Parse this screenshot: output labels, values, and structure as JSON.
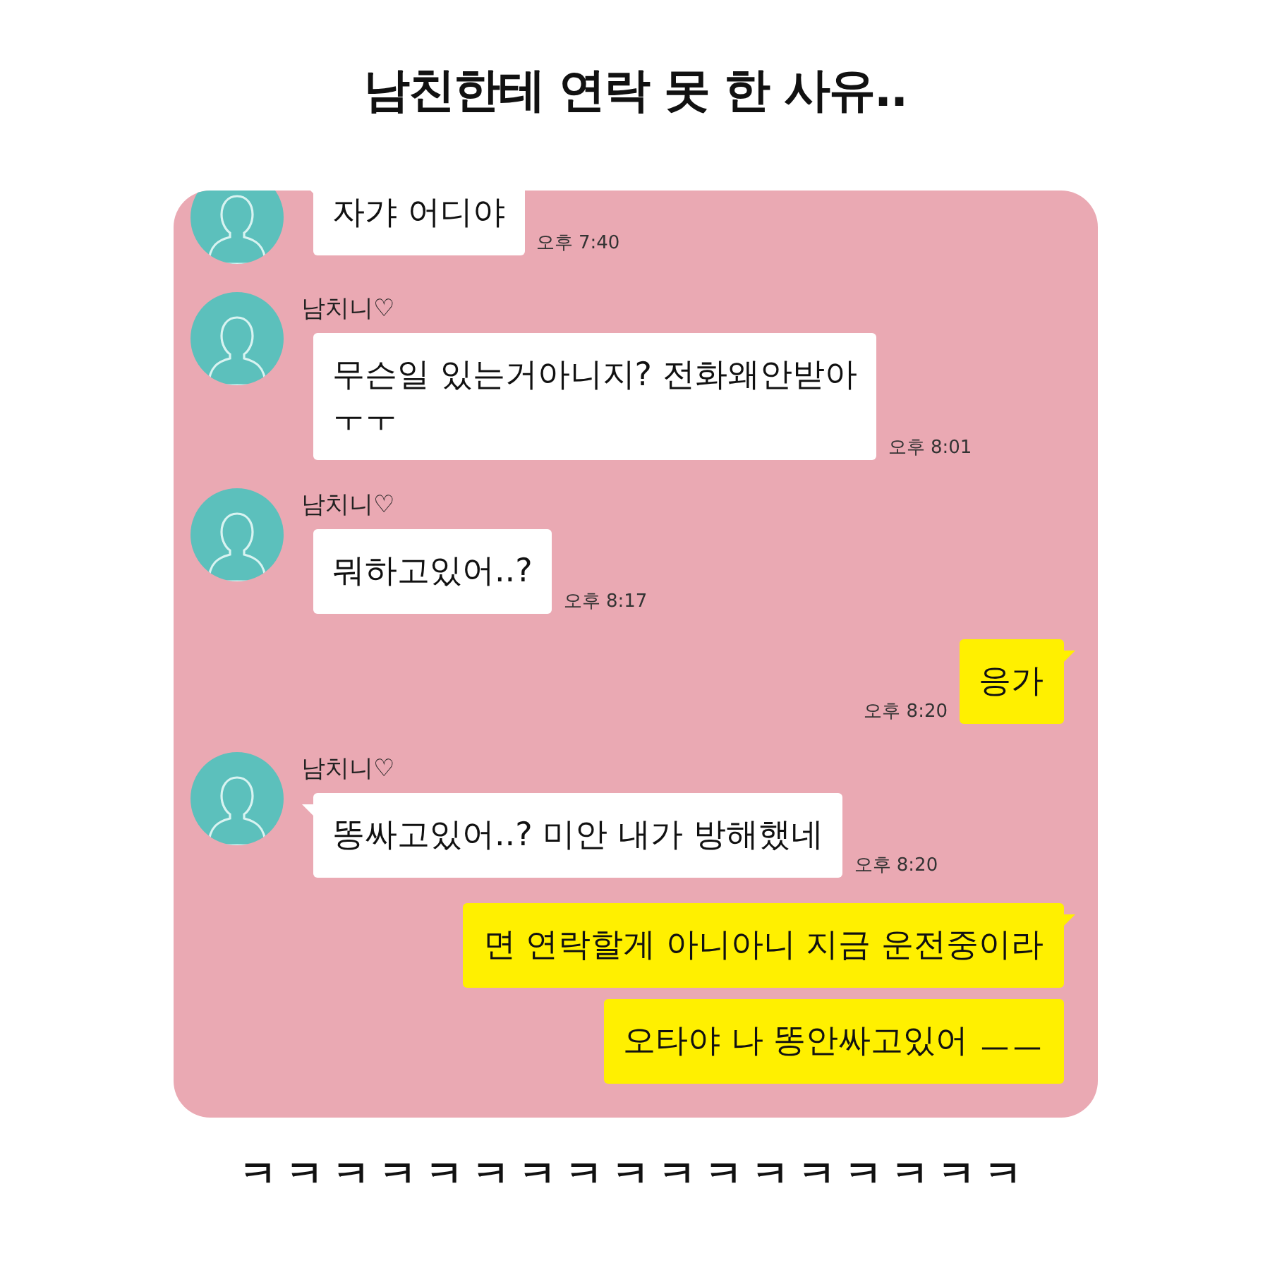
{
  "title": "남친한테 연락 못 한 사유..",
  "chat": {
    "messages": [
      {
        "kind": "received",
        "text": "자갸 어디야",
        "time": "오후 7:40"
      },
      {
        "kind": "received",
        "sender": "남치니♡",
        "text": "무슨일 있는거아니지? 전화왜안받아\nㅜㅜ",
        "time": "오후 8:01"
      },
      {
        "kind": "received",
        "sender": "남치니♡",
        "text": "뭐하고있어..?",
        "time": "오후 8:17"
      },
      {
        "kind": "sent",
        "text": "응가",
        "time": "오후 8:20"
      },
      {
        "kind": "received",
        "sender": "남치니♡",
        "text": "똥싸고있어..? 미안 내가 방해했네",
        "time": "오후 8:20"
      },
      {
        "kind": "sent",
        "text": "면 연락할게 아니아니 지금 운전중이라"
      },
      {
        "kind": "sent",
        "text": "오타야 나 똥안싸고있어 ㅡㅡ"
      }
    ]
  },
  "caption": "ㅋㅋㅋㅋㅋㅋㅋㅋㅋㅋㅋㅋㅋㅋㅋㅋㅋ"
}
